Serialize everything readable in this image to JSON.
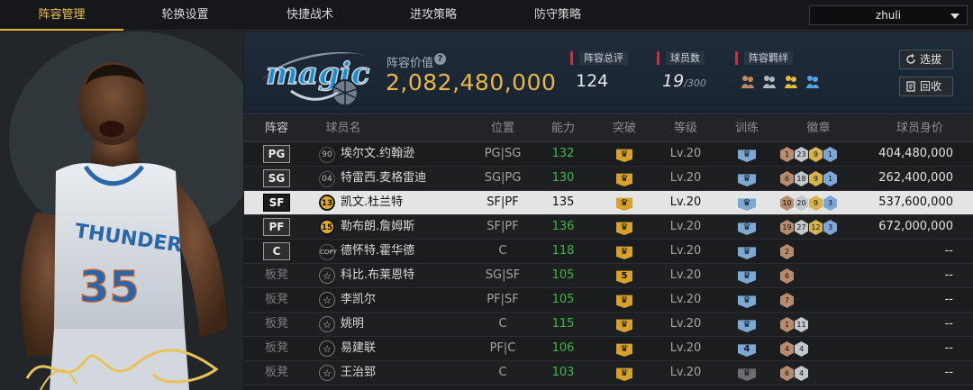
{
  "tabs": [
    "阵容管理",
    "轮换设置",
    "快捷战术",
    "进攻策略",
    "防守策略"
  ],
  "active_tab": 0,
  "account": "zhuli",
  "header": {
    "value_label": "阵容价值",
    "value": "2,082,480,000",
    "overall_label": "阵容总评",
    "overall": "124",
    "count_label": "球员数",
    "count": "19",
    "count_max": "/300",
    "chem_label": "阵容羁绊",
    "btn_select": "选拔",
    "btn_recycle": "回收"
  },
  "columns": [
    "阵容",
    "球员名",
    "位置",
    "能力",
    "突破",
    "等级",
    "训练",
    "徽章",
    "球员身价"
  ],
  "rows": [
    {
      "slot": "PG",
      "starter": true,
      "num": "90",
      "num_style": "plain",
      "name": "埃尔文.约翰逊",
      "position": "PG|SG",
      "rating": "132",
      "breakthrough": "",
      "level": "Lv.20",
      "train": "",
      "badges": [
        {
          "c": "bronze",
          "v": "1"
        },
        {
          "c": "silver",
          "v": "23"
        },
        {
          "c": "gold",
          "v": "9"
        },
        {
          "c": "blue",
          "v": "1"
        }
      ],
      "value": "404,480,000"
    },
    {
      "slot": "SG",
      "starter": true,
      "num": "04",
      "num_style": "plain",
      "name": "特雷西.麦格雷迪",
      "position": "SG|PG",
      "rating": "130",
      "breakthrough": "",
      "level": "Lv.20",
      "train": "",
      "badges": [
        {
          "c": "bronze",
          "v": "6"
        },
        {
          "c": "silver",
          "v": "18"
        },
        {
          "c": "gold",
          "v": "9"
        },
        {
          "c": "blue",
          "v": "1"
        }
      ],
      "value": "262,400,000"
    },
    {
      "slot": "SF",
      "starter": true,
      "num": "13",
      "num_style": "gold",
      "name": "凯文.杜兰特",
      "position": "SF|PF",
      "rating": "135",
      "breakthrough": "",
      "level": "Lv.20",
      "train": "",
      "badges": [
        {
          "c": "bronze",
          "v": "10"
        },
        {
          "c": "silver",
          "v": "20"
        },
        {
          "c": "gold",
          "v": "9"
        },
        {
          "c": "blue",
          "v": "3"
        }
      ],
      "value": "537,600,000",
      "selected": true
    },
    {
      "slot": "PF",
      "starter": true,
      "num": "15",
      "num_style": "gold",
      "name": "勒布朗.詹姆斯",
      "position": "SF|PF",
      "rating": "136",
      "breakthrough": "",
      "level": "Lv.20",
      "train": "",
      "badges": [
        {
          "c": "bronze",
          "v": "19"
        },
        {
          "c": "silver",
          "v": "27"
        },
        {
          "c": "gold",
          "v": "12"
        },
        {
          "c": "blue",
          "v": "3"
        }
      ],
      "value": "672,000,000"
    },
    {
      "slot": "C",
      "starter": true,
      "num": "COPY",
      "num_style": "copy",
      "name": "德怀特.霍华德",
      "position": "C",
      "rating": "118",
      "breakthrough": "",
      "level": "Lv.20",
      "train": "",
      "badges": [
        {
          "c": "bronze",
          "v": "2"
        }
      ],
      "value": "--"
    },
    {
      "slot": "板凳",
      "starter": false,
      "num": "☆",
      "num_style": "star",
      "name": "科比.布莱恩特",
      "position": "SG|SF",
      "rating": "105",
      "breakthrough": "5",
      "level": "Lv.20",
      "train": "",
      "badges": [
        {
          "c": "bronze",
          "v": "6"
        }
      ],
      "value": "--"
    },
    {
      "slot": "板凳",
      "starter": false,
      "num": "☆",
      "num_style": "star",
      "name": "李凯尔",
      "position": "PF|SF",
      "rating": "105",
      "breakthrough": "",
      "level": "Lv.20",
      "train": "",
      "badges": [
        {
          "c": "bronze",
          "v": "7"
        }
      ],
      "value": "--"
    },
    {
      "slot": "板凳",
      "starter": false,
      "num": "☆",
      "num_style": "star",
      "name": "姚明",
      "position": "C",
      "rating": "115",
      "breakthrough": "",
      "level": "Lv.20",
      "train": "",
      "badges": [
        {
          "c": "bronze",
          "v": "1"
        },
        {
          "c": "silver",
          "v": "11"
        }
      ],
      "value": "--"
    },
    {
      "slot": "板凳",
      "starter": false,
      "num": "☆",
      "num_style": "star",
      "name": "易建联",
      "position": "PF|C",
      "rating": "106",
      "breakthrough": "",
      "level": "Lv.20",
      "train": "4",
      "badges": [
        {
          "c": "bronze",
          "v": "4"
        },
        {
          "c": "silver",
          "v": "4"
        }
      ],
      "value": "--"
    },
    {
      "slot": "板凳",
      "starter": false,
      "num": "☆",
      "num_style": "star",
      "name": "王治郅",
      "position": "C",
      "rating": "103",
      "breakthrough": "",
      "level": "Lv.20",
      "train": "gray",
      "badges": [
        {
          "c": "bronze",
          "v": "6"
        },
        {
          "c": "silver",
          "v": "4"
        }
      ],
      "value": "--"
    }
  ]
}
